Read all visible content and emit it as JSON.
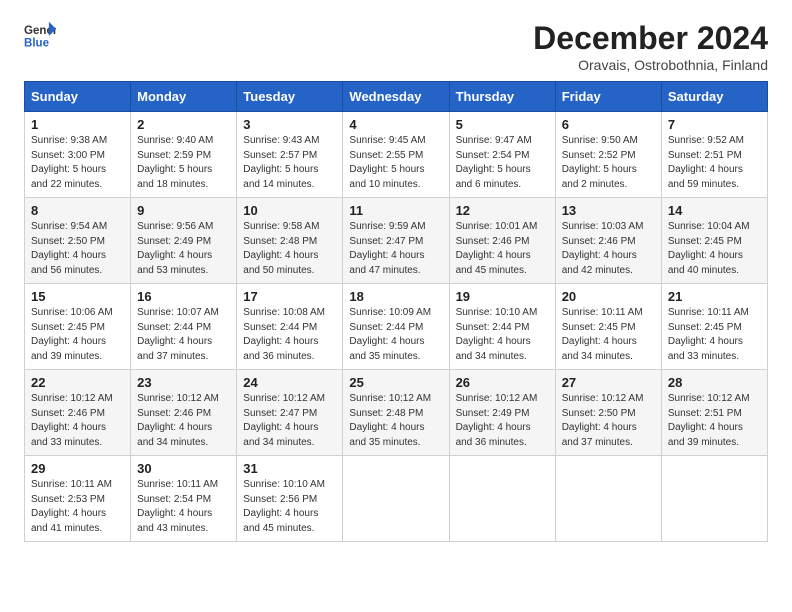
{
  "header": {
    "logo_general": "General",
    "logo_blue": "Blue",
    "title": "December 2024",
    "subtitle": "Oravais, Ostrobothnia, Finland"
  },
  "days_of_week": [
    "Sunday",
    "Monday",
    "Tuesday",
    "Wednesday",
    "Thursday",
    "Friday",
    "Saturday"
  ],
  "weeks": [
    [
      {
        "day": "1",
        "sunrise": "9:38 AM",
        "sunset": "3:00 PM",
        "daylight": "5 hours and 22 minutes."
      },
      {
        "day": "2",
        "sunrise": "9:40 AM",
        "sunset": "2:59 PM",
        "daylight": "5 hours and 18 minutes."
      },
      {
        "day": "3",
        "sunrise": "9:43 AM",
        "sunset": "2:57 PM",
        "daylight": "5 hours and 14 minutes."
      },
      {
        "day": "4",
        "sunrise": "9:45 AM",
        "sunset": "2:55 PM",
        "daylight": "5 hours and 10 minutes."
      },
      {
        "day": "5",
        "sunrise": "9:47 AM",
        "sunset": "2:54 PM",
        "daylight": "5 hours and 6 minutes."
      },
      {
        "day": "6",
        "sunrise": "9:50 AM",
        "sunset": "2:52 PM",
        "daylight": "5 hours and 2 minutes."
      },
      {
        "day": "7",
        "sunrise": "9:52 AM",
        "sunset": "2:51 PM",
        "daylight": "4 hours and 59 minutes."
      }
    ],
    [
      {
        "day": "8",
        "sunrise": "9:54 AM",
        "sunset": "2:50 PM",
        "daylight": "4 hours and 56 minutes."
      },
      {
        "day": "9",
        "sunrise": "9:56 AM",
        "sunset": "2:49 PM",
        "daylight": "4 hours and 53 minutes."
      },
      {
        "day": "10",
        "sunrise": "9:58 AM",
        "sunset": "2:48 PM",
        "daylight": "4 hours and 50 minutes."
      },
      {
        "day": "11",
        "sunrise": "9:59 AM",
        "sunset": "2:47 PM",
        "daylight": "4 hours and 47 minutes."
      },
      {
        "day": "12",
        "sunrise": "10:01 AM",
        "sunset": "2:46 PM",
        "daylight": "4 hours and 45 minutes."
      },
      {
        "day": "13",
        "sunrise": "10:03 AM",
        "sunset": "2:46 PM",
        "daylight": "4 hours and 42 minutes."
      },
      {
        "day": "14",
        "sunrise": "10:04 AM",
        "sunset": "2:45 PM",
        "daylight": "4 hours and 40 minutes."
      }
    ],
    [
      {
        "day": "15",
        "sunrise": "10:06 AM",
        "sunset": "2:45 PM",
        "daylight": "4 hours and 39 minutes."
      },
      {
        "day": "16",
        "sunrise": "10:07 AM",
        "sunset": "2:44 PM",
        "daylight": "4 hours and 37 minutes."
      },
      {
        "day": "17",
        "sunrise": "10:08 AM",
        "sunset": "2:44 PM",
        "daylight": "4 hours and 36 minutes."
      },
      {
        "day": "18",
        "sunrise": "10:09 AM",
        "sunset": "2:44 PM",
        "daylight": "4 hours and 35 minutes."
      },
      {
        "day": "19",
        "sunrise": "10:10 AM",
        "sunset": "2:44 PM",
        "daylight": "4 hours and 34 minutes."
      },
      {
        "day": "20",
        "sunrise": "10:11 AM",
        "sunset": "2:45 PM",
        "daylight": "4 hours and 34 minutes."
      },
      {
        "day": "21",
        "sunrise": "10:11 AM",
        "sunset": "2:45 PM",
        "daylight": "4 hours and 33 minutes."
      }
    ],
    [
      {
        "day": "22",
        "sunrise": "10:12 AM",
        "sunset": "2:46 PM",
        "daylight": "4 hours and 33 minutes."
      },
      {
        "day": "23",
        "sunrise": "10:12 AM",
        "sunset": "2:46 PM",
        "daylight": "4 hours and 34 minutes."
      },
      {
        "day": "24",
        "sunrise": "10:12 AM",
        "sunset": "2:47 PM",
        "daylight": "4 hours and 34 minutes."
      },
      {
        "day": "25",
        "sunrise": "10:12 AM",
        "sunset": "2:48 PM",
        "daylight": "4 hours and 35 minutes."
      },
      {
        "day": "26",
        "sunrise": "10:12 AM",
        "sunset": "2:49 PM",
        "daylight": "4 hours and 36 minutes."
      },
      {
        "day": "27",
        "sunrise": "10:12 AM",
        "sunset": "2:50 PM",
        "daylight": "4 hours and 37 minutes."
      },
      {
        "day": "28",
        "sunrise": "10:12 AM",
        "sunset": "2:51 PM",
        "daylight": "4 hours and 39 minutes."
      }
    ],
    [
      {
        "day": "29",
        "sunrise": "10:11 AM",
        "sunset": "2:53 PM",
        "daylight": "4 hours and 41 minutes."
      },
      {
        "day": "30",
        "sunrise": "10:11 AM",
        "sunset": "2:54 PM",
        "daylight": "4 hours and 43 minutes."
      },
      {
        "day": "31",
        "sunrise": "10:10 AM",
        "sunset": "2:56 PM",
        "daylight": "4 hours and 45 minutes."
      },
      null,
      null,
      null,
      null
    ]
  ]
}
